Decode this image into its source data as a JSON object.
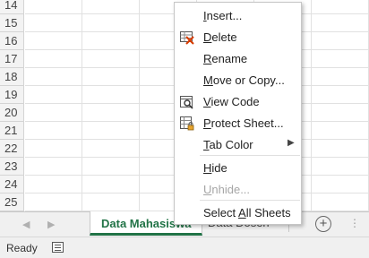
{
  "rows": [
    "14",
    "15",
    "16",
    "17",
    "18",
    "19",
    "20",
    "21",
    "22",
    "23",
    "24",
    "25"
  ],
  "context_menu": {
    "items": [
      {
        "label": "Insert...",
        "icon": "",
        "disabled": false
      },
      {
        "label": "Delete",
        "icon": "delete-sheet-icon",
        "disabled": false
      },
      {
        "label": "Rename",
        "icon": "",
        "disabled": false
      },
      {
        "label": "Move or Copy...",
        "icon": "",
        "disabled": false
      },
      {
        "label": "View Code",
        "icon": "view-code-icon",
        "disabled": false
      },
      {
        "label": "Protect Sheet...",
        "icon": "protect-sheet-icon",
        "disabled": false
      },
      {
        "label": "Tab Color",
        "icon": "",
        "disabled": false,
        "submenu": true
      },
      {
        "label": "Hide",
        "icon": "",
        "disabled": false
      },
      {
        "label": "Unhide...",
        "icon": "",
        "disabled": true
      },
      {
        "label": "Select All Sheets",
        "icon": "",
        "disabled": false
      }
    ]
  },
  "sheet_tabs": {
    "active": "Data Mahasiswa",
    "second": "Data Dosen",
    "add_symbol": "+",
    "overflow": "⋮"
  },
  "status": {
    "text": "Ready"
  },
  "colors": {
    "accent": "#217346",
    "delete_icon_red": "#d83b01"
  }
}
